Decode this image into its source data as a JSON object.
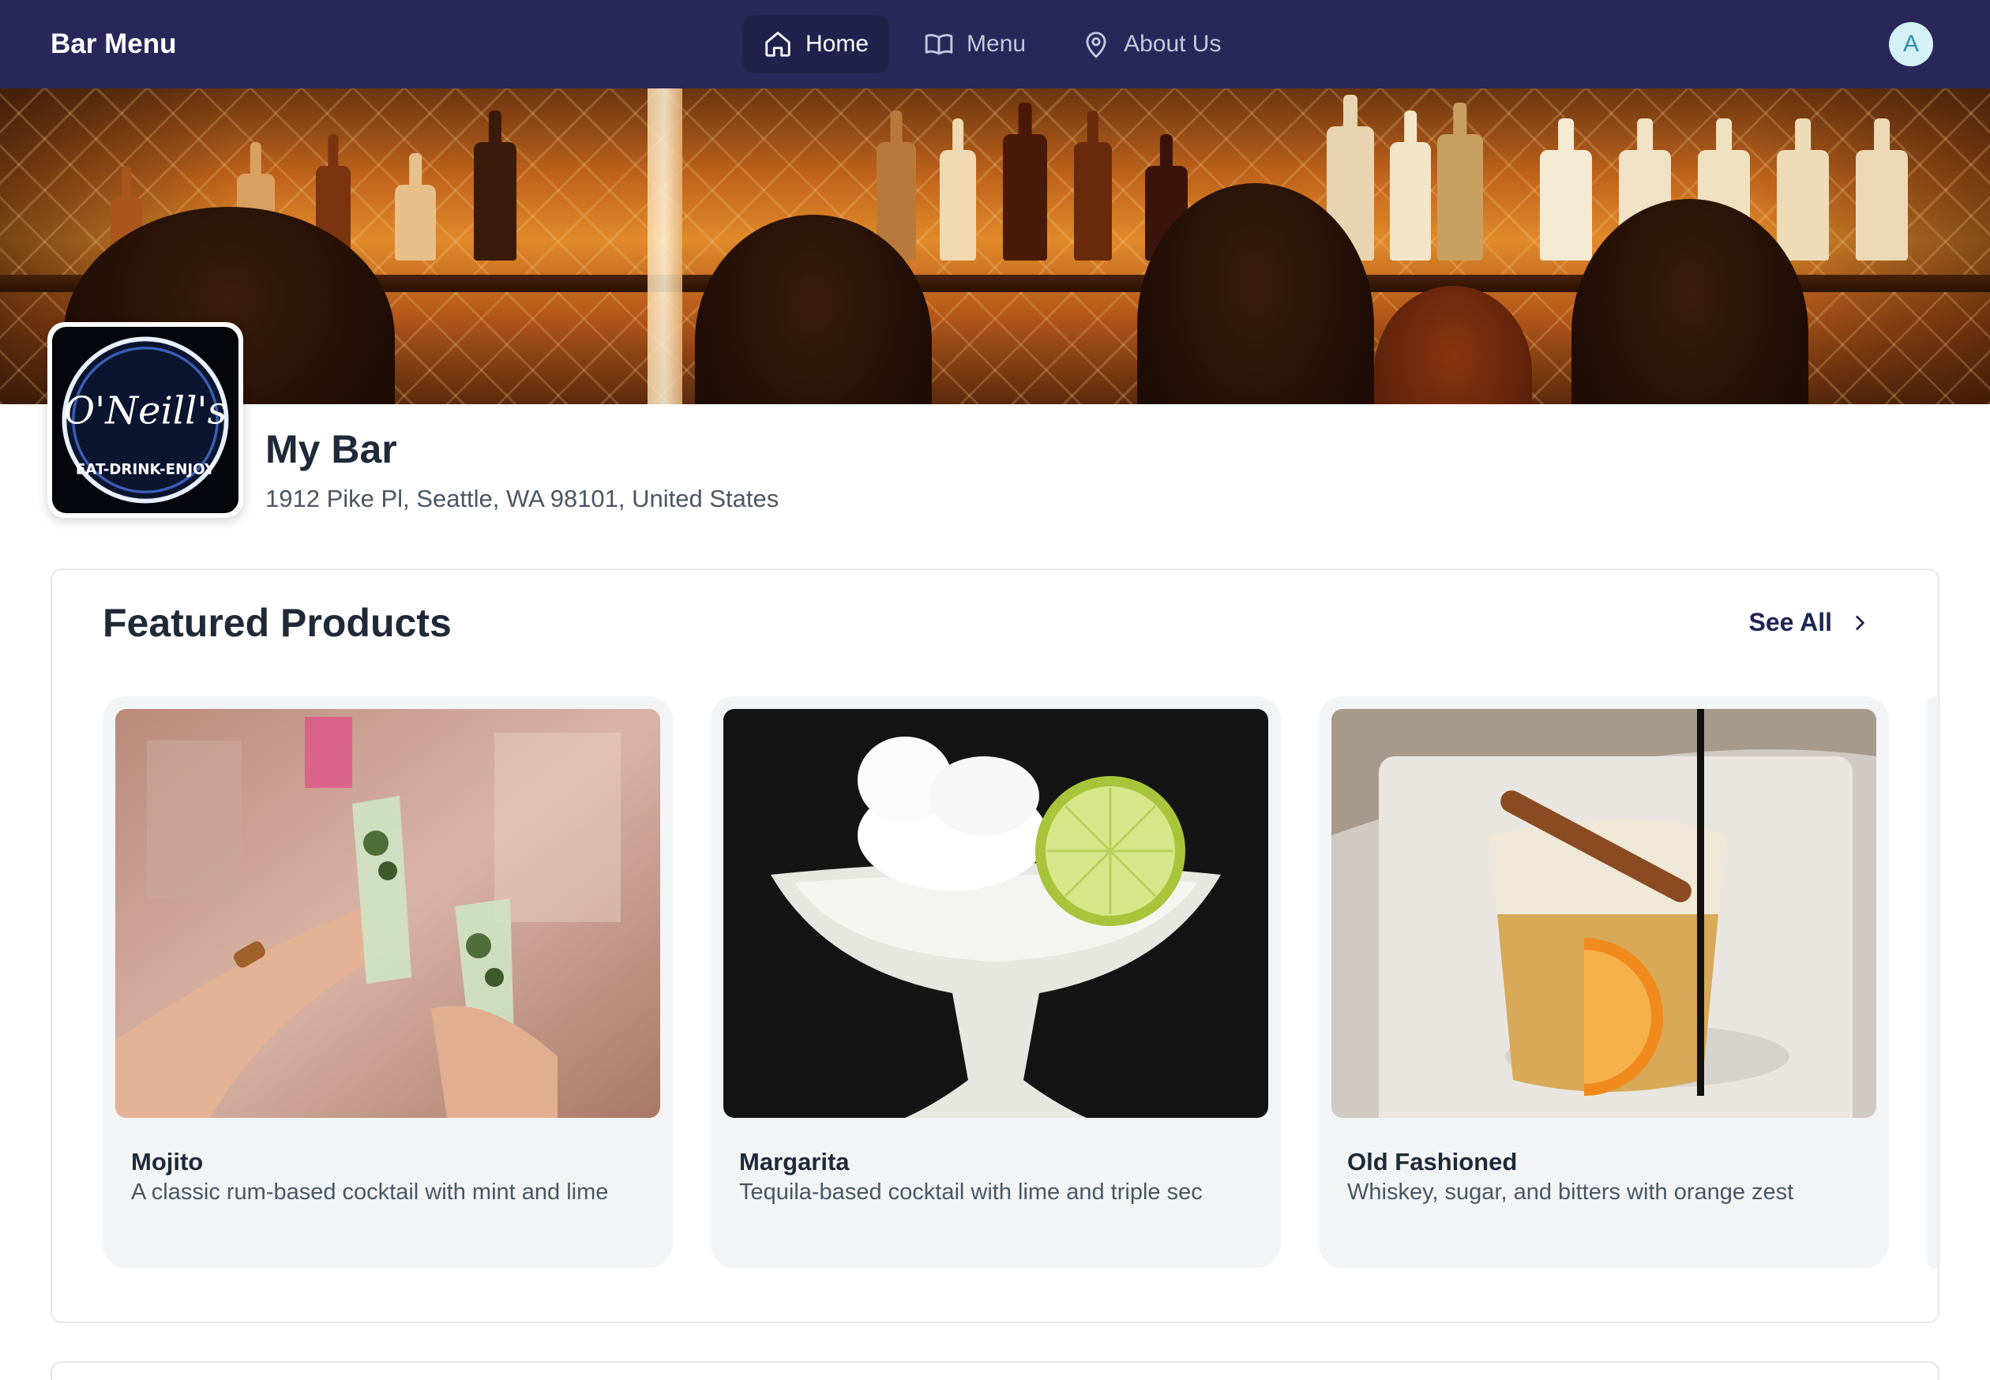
{
  "app": {
    "title": "Bar Menu"
  },
  "nav": {
    "items": [
      {
        "label": "Home",
        "icon": "home-icon",
        "active": true
      },
      {
        "label": "Menu",
        "icon": "book-open-icon",
        "active": false
      },
      {
        "label": "About Us",
        "icon": "map-pin-icon",
        "active": false
      }
    ]
  },
  "user": {
    "avatar_initial": "A"
  },
  "bar": {
    "name": "My Bar",
    "address": "1912 Pike Pl, Seattle, WA 98101, United States",
    "logo": {
      "alt": "O'Neill's EAT-DRINK-ENJOY neon logo"
    }
  },
  "featured": {
    "title": "Featured Products",
    "see_all_label": "See All",
    "products": [
      {
        "name": "Mojito",
        "description": "A classic rum-based cocktail with mint and lime"
      },
      {
        "name": "Margarita",
        "description": "Tequila-based cocktail with lime and triple sec"
      },
      {
        "name": "Old Fashioned",
        "description": "Whiskey, sugar, and bitters with orange zest"
      }
    ]
  },
  "colors": {
    "nav_bg": "#29275a",
    "nav_active_bg": "#22214c",
    "accent_dark": "#1e2555",
    "card_bg": "#f3f4f6",
    "avatar_bg": "#d4f1f6"
  }
}
